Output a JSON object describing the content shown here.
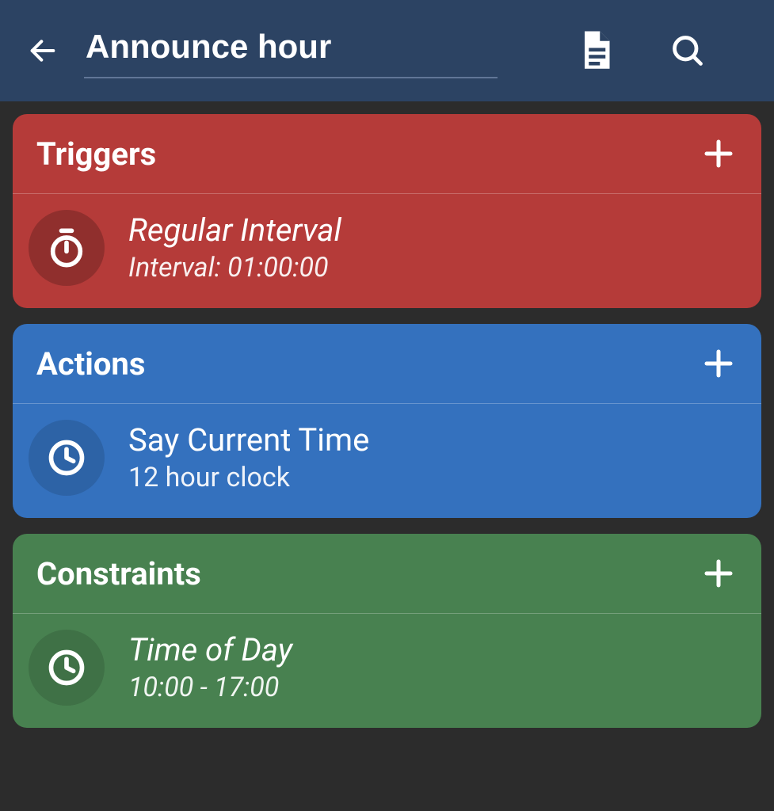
{
  "appbar": {
    "title": "Announce hour"
  },
  "sections": {
    "triggers": {
      "title": "Triggers",
      "item": {
        "title": "Regular Interval",
        "subtitle": "Interval: 01:00:00"
      }
    },
    "actions": {
      "title": "Actions",
      "item": {
        "title": "Say Current Time",
        "subtitle": "12 hour clock"
      }
    },
    "constraints": {
      "title": "Constraints",
      "item": {
        "title": "Time of Day",
        "subtitle": "10:00 - 17:00"
      }
    }
  }
}
